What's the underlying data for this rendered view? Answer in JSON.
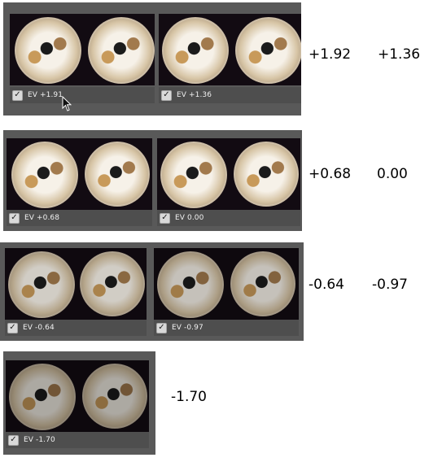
{
  "rows": [
    {
      "thumbs": [
        {
          "label": "EV +1.91",
          "checked": true
        },
        {
          "label": "EV +1.36",
          "checked": true
        }
      ],
      "values": [
        "+1.92",
        "+1.36"
      ]
    },
    {
      "thumbs": [
        {
          "label": "EV +0.68",
          "checked": true
        },
        {
          "label": "EV 0.00",
          "checked": true
        }
      ],
      "values": [
        "+0.68",
        "0.00"
      ]
    },
    {
      "thumbs": [
        {
          "label": "EV -0.64",
          "checked": true
        },
        {
          "label": "EV -0.97",
          "checked": true
        }
      ],
      "values": [
        "-0.64",
        "-0.97"
      ]
    },
    {
      "thumbs": [
        {
          "label": "EV -1.70",
          "checked": true
        }
      ],
      "values": [
        "-1.70"
      ]
    }
  ],
  "checkmark_glyph": "✓",
  "colors": {
    "panel": "#595959",
    "image_bg": "#120b12",
    "label_bar": "#4e4e4e"
  }
}
